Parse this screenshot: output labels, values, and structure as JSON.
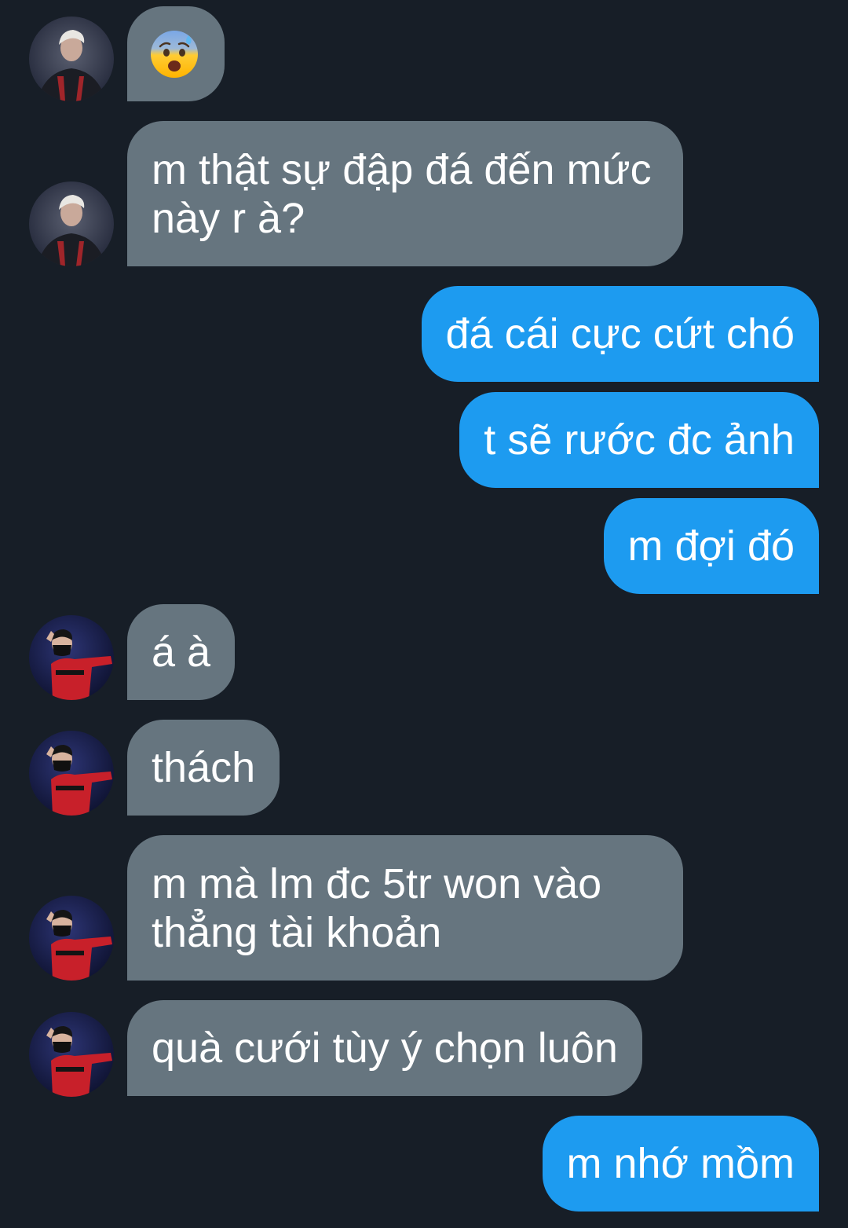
{
  "conversation": {
    "messages": [
      {
        "from": "them",
        "avatar": "avatar-a",
        "emoji": "anxious-face-with-sweat-icon",
        "text": ""
      },
      {
        "from": "them",
        "avatar": "avatar-a",
        "text": "m thật sự đập đá đến mức này r à?"
      },
      {
        "from": "me",
        "text": "đá cái cực cứt chó"
      },
      {
        "from": "me",
        "text": "t sẽ rước đc ảnh"
      },
      {
        "from": "me",
        "text": "m đợi đó"
      },
      {
        "from": "them",
        "avatar": "avatar-b",
        "text": "á à"
      },
      {
        "from": "them",
        "avatar": "avatar-b",
        "text": "thách"
      },
      {
        "from": "them",
        "avatar": "avatar-b",
        "text": "m mà lm đc 5tr won vào thẳng tài khoản"
      },
      {
        "from": "them",
        "avatar": "avatar-b",
        "text": "quà cưới tùy ý chọn luôn"
      },
      {
        "from": "me",
        "text": "m nhớ mồm"
      }
    ]
  },
  "colors": {
    "background": "#171e27",
    "incoming_bubble": "#66757f",
    "outgoing_bubble": "#1d9bf0",
    "text": "#ffffff"
  }
}
